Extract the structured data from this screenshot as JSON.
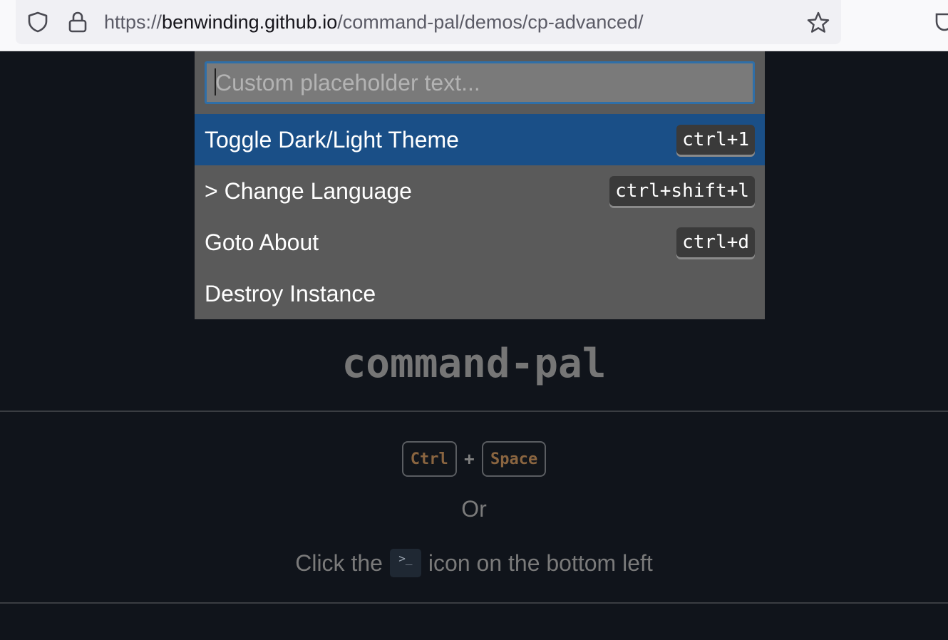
{
  "browser": {
    "url_scheme": "https://",
    "url_host": "benwinding.github.io",
    "url_path": "/command-pal/demos/cp-advanced/",
    "icons": [
      "shield-icon",
      "lock-icon",
      "star-icon",
      "pocket-icon"
    ]
  },
  "palette": {
    "placeholder": "Custom placeholder text...",
    "items": [
      {
        "label": "Toggle Dark/Light Theme",
        "shortcut": "ctrl+1"
      },
      {
        "label": "> Change Language",
        "shortcut": "ctrl+shift+l"
      },
      {
        "label": "Goto About",
        "shortcut": "ctrl+d"
      },
      {
        "label": "Destroy Instance",
        "shortcut": ""
      }
    ]
  },
  "page": {
    "title": "command-pal",
    "key1": "Ctrl",
    "plus": "+",
    "key2": "Space",
    "or_text": "Or",
    "click_prefix": "Click the",
    "terminal_glyph": ">_",
    "click_suffix": "icon on the bottom left"
  },
  "colors": {
    "page_bg": "#10141b",
    "palette_bg": "#5a5a5a",
    "selected_bg": "#1a4f87",
    "input_border": "#2f6fa8",
    "key_text": "#8a6540"
  }
}
